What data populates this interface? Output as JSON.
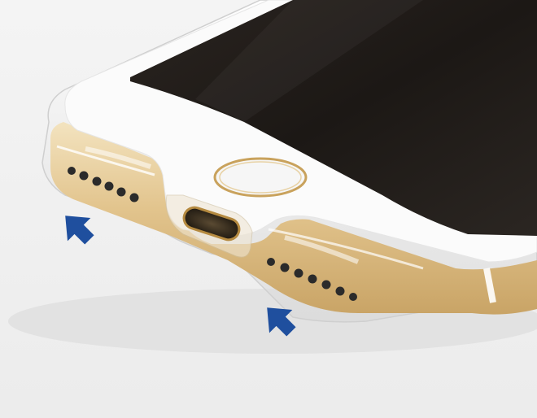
{
  "photo": {
    "subject": "smartphone-bottom-edge-in-clear-case",
    "colors": {
      "background": "#f1f1f1",
      "phone_body_gold": "#e2c48d",
      "phone_front_white": "#fbfbfb",
      "screen_black": "#1c1815",
      "home_button_ring": "#c9a25c",
      "arrow_blue": "#1f4f9e",
      "speaker_hole": "#2b2b2b"
    },
    "icons": {
      "left_arrow": "arrow-up-right-icon",
      "right_arrow": "arrow-up-right-icon"
    }
  }
}
